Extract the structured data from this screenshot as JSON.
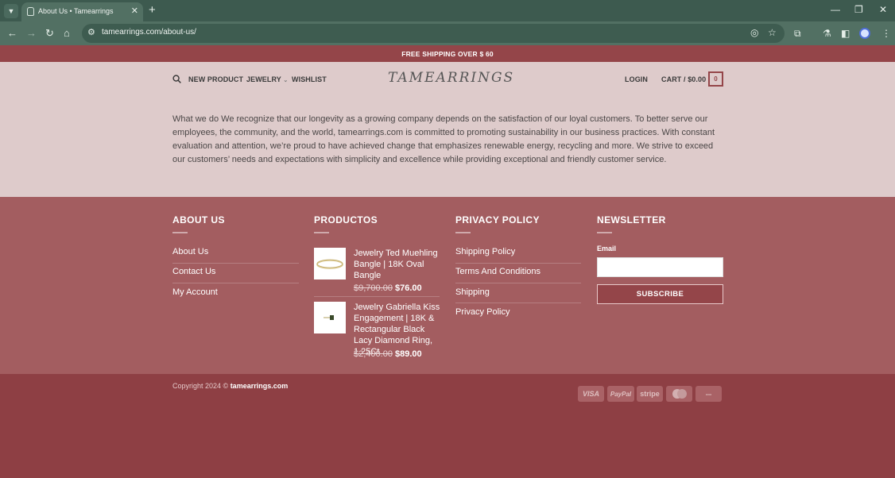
{
  "browser": {
    "tab_title": "About Us • Tamearrings",
    "url": "tamearrings.com/about-us/"
  },
  "topbar": {
    "text": "FREE SHIPPING OVER $ 60"
  },
  "header": {
    "nav": [
      "NEW PRODUCT",
      "JEWELRY",
      "WISHLIST"
    ],
    "logo": "TAMEARRINGS",
    "login": "LOGIN",
    "cart": "CART / $0.00",
    "cart_count": "0"
  },
  "main": {
    "intro": "What we do We recognize that our longevity as a growing company depends on the satisfaction of our loyal customers. To better serve our employees, the community, and the world, tamearrings.com is committed to promoting sustainability in our business practices. With constant evaluation and attention, we’re proud to have achieved change that emphasizes renewable energy, recycling and more. We strive to exceed our customers’ needs and expectations with simplicity and excellence while providing exceptional and friendly customer service."
  },
  "footer": {
    "about": {
      "title": "ABOUT US",
      "links": [
        "About Us",
        "Contact Us",
        "My Account"
      ]
    },
    "products": {
      "title": "PRODUCTOS",
      "items": [
        {
          "title": "Jewelry Ted Muehling Bangle | 18K Oval Bangle",
          "old_price": "$9,700.00",
          "price": "$76.00"
        },
        {
          "title": "Jewelry Gabriella Kiss Engagement | 18K & Rectangular Black Lacy Diamond Ring, 1.25Ct",
          "old_price": "$2,400.00",
          "price": "$89.00"
        }
      ]
    },
    "privacy": {
      "title": "PRIVACY POLICY",
      "links": [
        "Shipping Policy",
        "Terms And Conditions",
        "Shipping",
        "Privacy Policy"
      ]
    },
    "newsletter": {
      "title": "NEWSLETTER",
      "email_label": "Email",
      "button": "SUBSCRIBE"
    }
  },
  "bottom": {
    "copyright_prefix": "Copyright 2024 ©",
    "copyright_site": "tamearrings.com",
    "payments": [
      "VISA",
      "PayPal",
      "stripe",
      "mastercard",
      "cash-on-delivery"
    ],
    "payment_labels": {
      "visa": "VISA",
      "paypal": "PayPal",
      "stripe": "stripe"
    }
  },
  "colors": {
    "brand": "#944549",
    "header_bg": "#decbcb",
    "footer_bg": "#a35d60",
    "bottom_bg": "#8e3f44"
  }
}
